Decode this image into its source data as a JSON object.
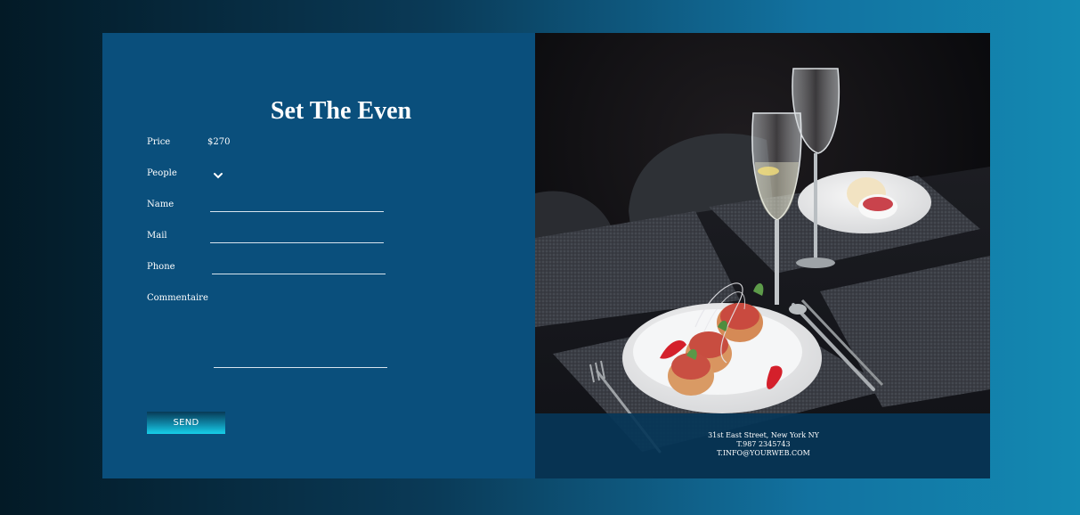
{
  "form": {
    "title": "Set The Even",
    "price_label": "Price",
    "price_value": "$270",
    "people_label": "People",
    "name_label": "Name",
    "mail_label": "Mail",
    "phone_label": "Phone",
    "comment_label": "Commentaire",
    "send_label": "SEND"
  },
  "contact": {
    "address": "31st East Street, New York NY",
    "phone": "T.987 2345743",
    "email": "T.INFO@YOURWEB.COM"
  },
  "colors": {
    "panel": "#0a4f7c",
    "send_gradient_bottom": "#17d0ea",
    "info_bar": "#063658"
  },
  "icons": {
    "people_dropdown": "chevron-down-icon"
  }
}
